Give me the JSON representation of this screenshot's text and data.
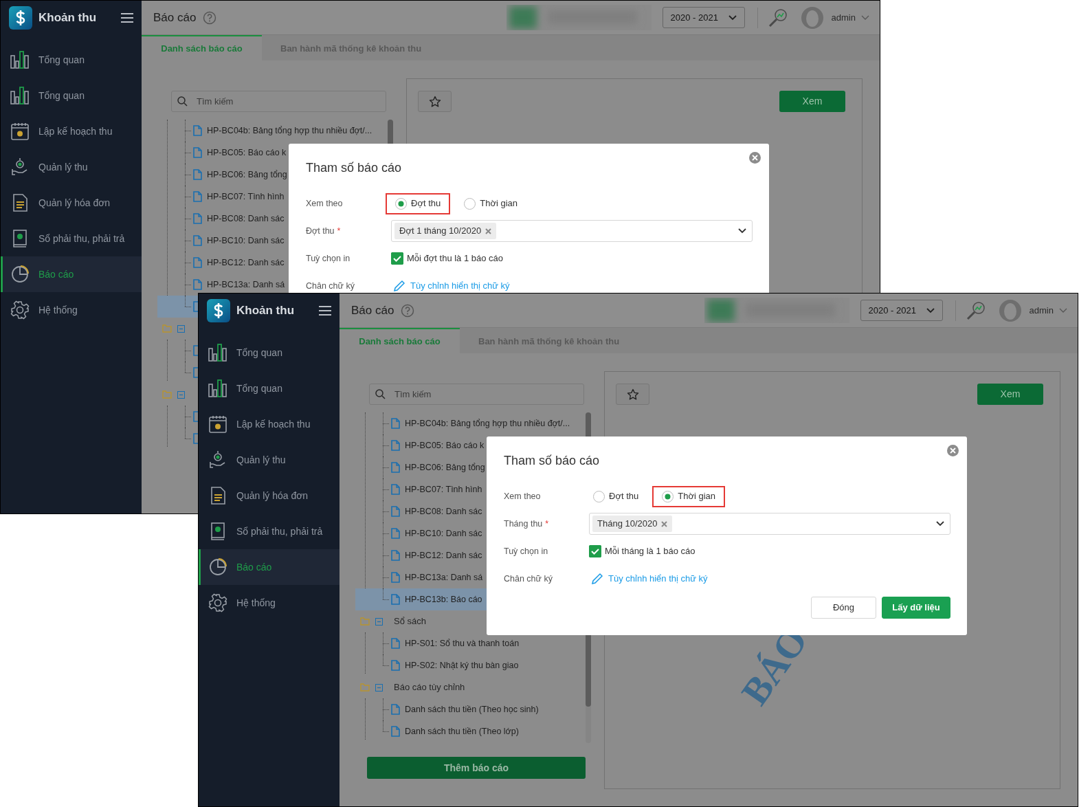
{
  "windows": [
    {
      "app_title": "Khoản thu",
      "menu": [
        {
          "label": "Tổng quan",
          "kind": "bars",
          "selected": false
        },
        {
          "label": "Tổng quan",
          "kind": "bars",
          "selected": false
        },
        {
          "label": "Lập kế hoạch thu",
          "kind": "calendar",
          "selected": false
        },
        {
          "label": "Quản lý thu",
          "kind": "hand",
          "selected": false
        },
        {
          "label": "Quản lý hóa đơn",
          "kind": "invoice",
          "selected": false
        },
        {
          "label": "Sổ phải thu, phải trả",
          "kind": "book",
          "selected": false
        },
        {
          "label": "Báo cáo",
          "kind": "pie",
          "selected": true
        },
        {
          "label": "Hệ thống",
          "kind": "gear",
          "selected": false
        }
      ],
      "page_title": "Báo cáo",
      "year_select": "2020 - 2021",
      "user": "admin",
      "tabs": [
        {
          "label": "Danh sách báo cáo",
          "selected": true
        },
        {
          "label": "Ban hành mã thống kê khoản thu",
          "selected": false
        }
      ],
      "search": {
        "placeholder": "Tìm kiếm"
      },
      "tree": [
        {
          "kind": "group",
          "children": [
            {
              "kind": "report",
              "label": "HP-BC04b: Bảng tổng hợp thu nhiều đợt/...",
              "selected": false
            },
            {
              "kind": "report",
              "label": "HP-BC05: Báo cáo k",
              "selected": false
            },
            {
              "kind": "report",
              "label": "HP-BC06: Bảng tổng",
              "selected": false
            },
            {
              "kind": "report",
              "label": "HP-BC07: Tình hình",
              "selected": false
            },
            {
              "kind": "report",
              "label": "HP-BC08: Danh sác",
              "selected": false
            },
            {
              "kind": "report",
              "label": "HP-BC10: Danh sác",
              "selected": false
            },
            {
              "kind": "report",
              "label": "HP-BC12: Danh sác",
              "selected": false
            },
            {
              "kind": "report",
              "label": "HP-BC13a: Danh sá",
              "selected": false
            },
            {
              "kind": "report",
              "selected": true
            }
          ]
        },
        {
          "kind": "folder",
          "expanded": true,
          "children": [
            {
              "kind": "report"
            },
            {
              "kind": "report"
            }
          ]
        },
        {
          "kind": "folder",
          "expanded": true,
          "children": [
            {
              "kind": "report"
            },
            {
              "kind": "report"
            }
          ]
        }
      ],
      "view_button": "Xem",
      "dialog": {
        "title": "Tham số báo cáo",
        "view_by": {
          "label": "Xem theo",
          "options": [
            {
              "label": "Đợt thu",
              "selected": true,
              "highlighted": true
            },
            {
              "label": "Thời gian",
              "selected": false,
              "highlighted": false
            }
          ]
        },
        "period": {
          "label": "Đợt thu",
          "required_mark": "*",
          "tags": [
            "Đợt 1 tháng 10/2020"
          ]
        },
        "print_option": {
          "label": "Tuỳ chọn in",
          "checkbox_label": "Mỗi đợt thu là 1 báo cáo",
          "checked": true
        },
        "signature": {
          "label": "Chân chữ ký",
          "link": "Tùy chỉnh hiển thị chữ ký"
        }
      }
    },
    {
      "app_title": "Khoản thu",
      "menu": [
        {
          "label": "Tổng quan",
          "kind": "bars",
          "selected": false
        },
        {
          "label": "Tổng quan",
          "kind": "bars",
          "selected": false
        },
        {
          "label": "Lập kế hoạch thu",
          "kind": "calendar",
          "selected": false
        },
        {
          "label": "Quản lý thu",
          "kind": "hand",
          "selected": false
        },
        {
          "label": "Quản lý hóa đơn",
          "kind": "invoice",
          "selected": false
        },
        {
          "label": "Sổ phải thu, phải trả",
          "kind": "book",
          "selected": false
        },
        {
          "label": "Báo cáo",
          "kind": "pie",
          "selected": true
        },
        {
          "label": "Hệ thống",
          "kind": "gear",
          "selected": false
        }
      ],
      "page_title": "Báo cáo",
      "year_select": "2020 - 2021",
      "user": "admin",
      "tabs": [
        {
          "label": "Danh sách báo cáo",
          "selected": true
        },
        {
          "label": "Ban hành mã thống kê khoản thu",
          "selected": false
        }
      ],
      "search": {
        "placeholder": "Tìm kiếm"
      },
      "tree": [
        {
          "kind": "group",
          "children": [
            {
              "kind": "report",
              "label": "HP-BC04b: Bảng tổng hợp thu nhiều đợt/...",
              "selected": false
            },
            {
              "kind": "report",
              "label": "HP-BC05: Báo cáo k",
              "selected": false
            },
            {
              "kind": "report",
              "label": "HP-BC06: Bảng tổng",
              "selected": false
            },
            {
              "kind": "report",
              "label": "HP-BC07: Tình hình",
              "selected": false
            },
            {
              "kind": "report",
              "label": "HP-BC08: Danh sác",
              "selected": false
            },
            {
              "kind": "report",
              "label": "HP-BC10: Danh sác",
              "selected": false
            },
            {
              "kind": "report",
              "label": "HP-BC12: Danh sác",
              "selected": false
            },
            {
              "kind": "report",
              "label": "HP-BC13a: Danh sá",
              "selected": false
            },
            {
              "kind": "report",
              "label": "HP-BC13b: Báo cáo",
              "selected": true
            }
          ]
        },
        {
          "kind": "folder",
          "label": "Sổ sách",
          "expanded": true,
          "children": [
            {
              "kind": "report",
              "label": "HP-S01: Sổ thu và thanh toán",
              "selected": false
            },
            {
              "kind": "report",
              "label": "HP-S02: Nhật ký thu bàn giao",
              "selected": false
            }
          ]
        },
        {
          "kind": "folder",
          "label": "Báo cáo tùy chỉnh",
          "expanded": true,
          "children": [
            {
              "kind": "report",
              "label": "Danh sách thu tiền (Theo học sinh)",
              "selected": false
            },
            {
              "kind": "report",
              "label": "Danh sách thu tiền (Theo lớp)",
              "selected": false
            }
          ]
        }
      ],
      "add_button": "Thêm báo cáo",
      "view_button": "Xem",
      "preview": {
        "watermark": "BÁO"
      },
      "dialog": {
        "title": "Tham số báo cáo",
        "view_by": {
          "label": "Xem theo",
          "options": [
            {
              "label": "Đợt thu",
              "selected": false,
              "highlighted": false
            },
            {
              "label": "Thời gian",
              "selected": true,
              "highlighted": true
            }
          ]
        },
        "period": {
          "label": "Tháng thu",
          "required_mark": "*",
          "tags": [
            "Tháng 10/2020"
          ]
        },
        "print_option": {
          "label": "Tuỳ chọn in",
          "checkbox_label": "Mỗi tháng là 1 báo cáo",
          "checked": true
        },
        "signature": {
          "label": "Chân chữ ký",
          "link": "Tùy chỉnh hiển thị chữ ký"
        },
        "buttons": [
          {
            "label": "Đóng",
            "kind": "secondary"
          },
          {
            "label": "Lấy dữ liệu",
            "kind": "primary"
          }
        ]
      }
    }
  ]
}
